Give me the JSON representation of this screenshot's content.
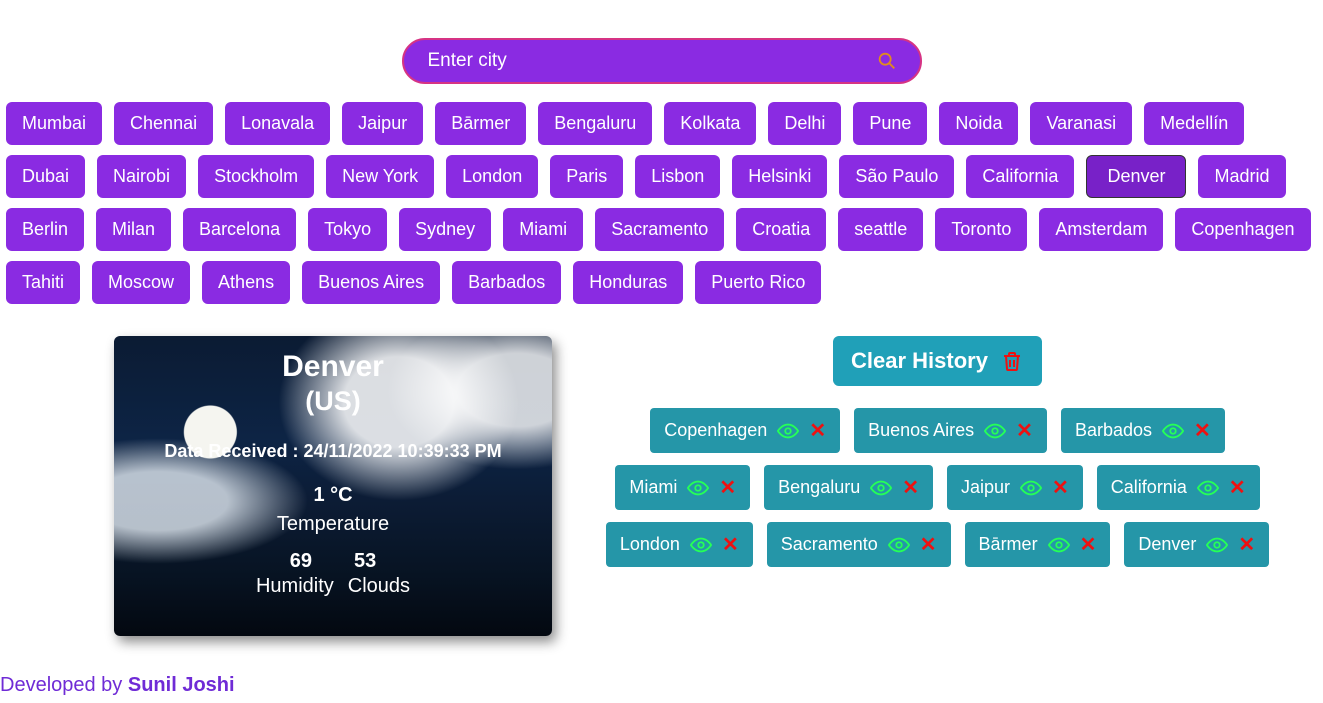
{
  "search": {
    "placeholder": "Enter city"
  },
  "cities": [
    "Mumbai",
    "Chennai",
    "Lonavala",
    "Jaipur",
    "Bārmer",
    "Bengaluru",
    "Kolkata",
    "Delhi",
    "Pune",
    "Noida",
    "Varanasi",
    "Medellín",
    "Dubai",
    "Nairobi",
    "Stockholm",
    "New York",
    "London",
    "Paris",
    "Lisbon",
    "Helsinki",
    "São Paulo",
    "California",
    "Denver",
    "Madrid",
    "Berlin",
    "Milan",
    "Barcelona",
    "Tokyo",
    "Sydney",
    "Miami",
    "Sacramento",
    "Croatia",
    "seattle",
    "Toronto",
    "Amsterdam",
    "Copenhagen",
    "Tahiti",
    "Moscow",
    "Athens",
    "Buenos Aires",
    "Barbados",
    "Honduras",
    "Puerto Rico"
  ],
  "active_city": "Denver",
  "card": {
    "city": "Denver",
    "country": "(US)",
    "received_label": "Data Received : 24/11/2022 10:39:33 PM",
    "temp_value": "1 °C",
    "temp_label": "Temperature",
    "humidity_value": "69",
    "clouds_value": "53",
    "humidity_label": "Humidity",
    "clouds_label": "Clouds"
  },
  "clear_history_label": "Clear History",
  "history": [
    "Copenhagen",
    "Buenos Aires",
    "Barbados",
    "Miami",
    "Bengaluru",
    "Jaipur",
    "California",
    "London",
    "Sacramento",
    "Bārmer",
    "Denver"
  ],
  "footer": {
    "prefix": "Developed by ",
    "author": "Sunil Joshi"
  }
}
